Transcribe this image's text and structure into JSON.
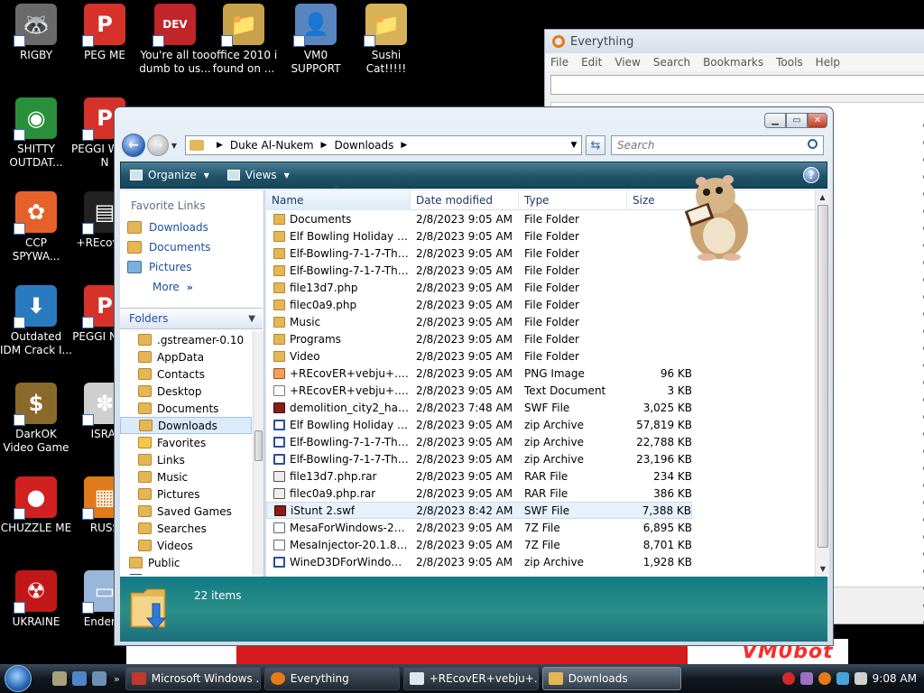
{
  "desktop": {
    "icons": [
      {
        "label": "RIGBY",
        "color": "#6a6a6a",
        "glyph": "🦝"
      },
      {
        "label": "PEG ME",
        "color": "#d6322a",
        "glyph": "P"
      },
      {
        "label": "You're all too dumb to us...",
        "color": "#c0252a",
        "glyph": "DEV"
      },
      {
        "label": "office 2010 i found on ...",
        "color": "#c7a24a",
        "glyph": "📁"
      },
      {
        "label": "VM0 SUPPORT",
        "color": "#5a86c0",
        "glyph": "👤"
      },
      {
        "label": "Sushi Cat!!!!!",
        "color": "#d8b258",
        "glyph": "📁"
      },
      {
        "label": "SHITTY OUTDAT...",
        "color": "#2a8f3a",
        "glyph": "◉"
      },
      {
        "label": "PEGGI WOW N",
        "color": "#d6322a",
        "glyph": "P"
      },
      {
        "label": "CCP SPYWA...",
        "color": "#e6612a",
        "glyph": "✿"
      },
      {
        "label": "+REcovER",
        "color": "#222222",
        "glyph": "▤"
      },
      {
        "label": "Outdated IDM Crack I...",
        "color": "#2a7ac0",
        "glyph": "⬇"
      },
      {
        "label": "PEGGI NIGH",
        "color": "#d6322a",
        "glyph": "P"
      },
      {
        "label": "DarkOK Video Game",
        "color": "#8a6a2a",
        "glyph": "$"
      },
      {
        "label": "ISRAI",
        "color": "#cfcfcf",
        "glyph": "✽"
      },
      {
        "label": "CHUZZLE ME",
        "color": "#d02020",
        "glyph": "●"
      },
      {
        "label": "RUSS",
        "color": "#e07a1a",
        "glyph": "▦"
      },
      {
        "label": "UKRAINE",
        "color": "#c01818",
        "glyph": "☢"
      },
      {
        "label": "Enderm",
        "color": "#9ab6d8",
        "glyph": "▭"
      }
    ],
    "logo_text": "VM0bot"
  },
  "everything_window": {
    "title": "Everything",
    "menu": [
      "File",
      "Edit",
      "View",
      "Search",
      "Bookmarks",
      "Tools",
      "Help"
    ]
  },
  "explorer": {
    "breadcrumb": [
      "Duke Al-Nukem",
      "Downloads"
    ],
    "search_placeholder": "Search",
    "toolbar": {
      "organize": "Organize",
      "views": "Views"
    },
    "favorite_links_title": "Favorite Links",
    "favorite_links": [
      "Downloads",
      "Documents",
      "Pictures"
    ],
    "more_label": "More",
    "folders_title": "Folders",
    "tree": [
      ".gstreamer-0.10",
      "AppData",
      "Contacts",
      "Desktop",
      "Documents",
      "Downloads",
      "Favorites",
      "Links",
      "Music",
      "Pictures",
      "Saved Games",
      "Searches",
      "Videos",
      "Public",
      "Computer"
    ],
    "columns": {
      "name": "Name",
      "date": "Date modified",
      "type": "Type",
      "size": "Size"
    },
    "files": [
      {
        "name": "Documents",
        "date": "2/8/2023 9:05 AM",
        "type": "File Folder",
        "size": "",
        "kind": "folder"
      },
      {
        "name": "Elf Bowling Holiday Pa...",
        "date": "2/8/2023 9:05 AM",
        "type": "File Folder",
        "size": "",
        "kind": "folder"
      },
      {
        "name": "Elf-Bowling-7-1-7-The...",
        "date": "2/8/2023 9:05 AM",
        "type": "File Folder",
        "size": "",
        "kind": "folder"
      },
      {
        "name": "Elf-Bowling-7-1-7-The...",
        "date": "2/8/2023 9:05 AM",
        "type": "File Folder",
        "size": "",
        "kind": "folder"
      },
      {
        "name": "file13d7.php",
        "date": "2/8/2023 9:05 AM",
        "type": "File Folder",
        "size": "",
        "kind": "folder"
      },
      {
        "name": "filec0a9.php",
        "date": "2/8/2023 9:05 AM",
        "type": "File Folder",
        "size": "",
        "kind": "folder"
      },
      {
        "name": "Music",
        "date": "2/8/2023 9:05 AM",
        "type": "File Folder",
        "size": "",
        "kind": "folder"
      },
      {
        "name": "Programs",
        "date": "2/8/2023 9:05 AM",
        "type": "File Folder",
        "size": "",
        "kind": "folder"
      },
      {
        "name": "Video",
        "date": "2/8/2023 9:05 AM",
        "type": "File Folder",
        "size": "",
        "kind": "folder"
      },
      {
        "name": "+REcovER+vebju+.png",
        "date": "2/8/2023 9:05 AM",
        "type": "PNG Image",
        "size": "96 KB",
        "kind": "png"
      },
      {
        "name": "+REcovER+vebju+.txt",
        "date": "2/8/2023 9:05 AM",
        "type": "Text Document",
        "size": "3 KB",
        "kind": "txt"
      },
      {
        "name": "demolition_city2_hack....",
        "date": "2/8/2023 7:48 AM",
        "type": "SWF File",
        "size": "3,025 KB",
        "kind": "swf"
      },
      {
        "name": "Elf Bowling Holiday Pa...",
        "date": "2/8/2023 9:05 AM",
        "type": "zip Archive",
        "size": "57,819 KB",
        "kind": "zip"
      },
      {
        "name": "Elf-Bowling-7-1-7-The...",
        "date": "2/8/2023 9:05 AM",
        "type": "zip Archive",
        "size": "22,788 KB",
        "kind": "zip"
      },
      {
        "name": "Elf-Bowling-7-1-7-The...",
        "date": "2/8/2023 9:05 AM",
        "type": "zip Archive",
        "size": "23,196 KB",
        "kind": "zip"
      },
      {
        "name": "file13d7.php.rar",
        "date": "2/8/2023 9:05 AM",
        "type": "RAR File",
        "size": "234 KB",
        "kind": "rar"
      },
      {
        "name": "filec0a9.php.rar",
        "date": "2/8/2023 9:05 AM",
        "type": "RAR File",
        "size": "386 KB",
        "kind": "rar"
      },
      {
        "name": "iStunt 2.swf",
        "date": "2/8/2023 8:42 AM",
        "type": "SWF File",
        "size": "7,388 KB",
        "kind": "swf"
      },
      {
        "name": "MesaForWindows-20.1...",
        "date": "2/8/2023 9:05 AM",
        "type": "7Z File",
        "size": "6,895 KB",
        "kind": "z7"
      },
      {
        "name": "MesaInjector-20.1.8.7z",
        "date": "2/8/2023 9:05 AM",
        "type": "7Z File",
        "size": "8,701 KB",
        "kind": "z7"
      },
      {
        "name": "WineD3DForWindows_...",
        "date": "2/8/2023 9:05 AM",
        "type": "zip Archive",
        "size": "1,928 KB",
        "kind": "zip"
      }
    ],
    "hovered_index": 17,
    "item_count": "22 items"
  },
  "taskbar": {
    "tasks": [
      {
        "label": "Microsoft Windows ...",
        "color": "#c0392b"
      },
      {
        "label": "Everything",
        "color": "#e87a13"
      },
      {
        "label": "+REcovER+vebju+.t...",
        "color": "#dfe6ee"
      },
      {
        "label": "Downloads",
        "color": "#e5b656"
      }
    ],
    "active_task": 3,
    "clock": "9:08 AM"
  }
}
